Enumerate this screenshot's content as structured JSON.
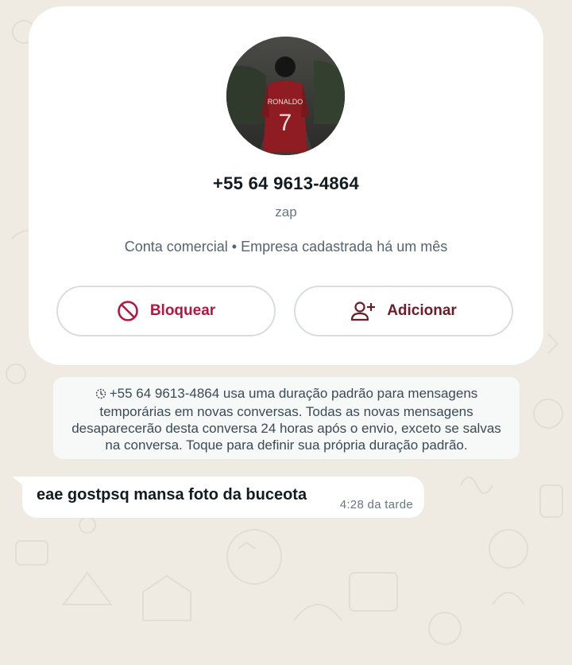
{
  "profile": {
    "phone": "+55 64 9613-4864",
    "name": "zap",
    "business_line": "Conta comercial • Empresa cadastrada há um mês",
    "avatar_shirt_text": "RONALDO",
    "avatar_shirt_number": "7"
  },
  "actions": {
    "block_label": "Bloquear",
    "add_label": "Adicionar"
  },
  "system_message": {
    "text": "+55 64 9613-4864 usa uma duração padrão para mensagens temporárias em novas conversas. Todas as novas mensagens desaparecerão desta conversa 24 horas após o envio, exceto se salvas na conversa. Toque para definir sua própria duração padrão."
  },
  "message": {
    "text": "eae gostpsq mansa foto da buceota",
    "time": "4:28 da tarde"
  },
  "colors": {
    "block_accent": "#b3183f",
    "add_accent": "#6b1d2a",
    "chat_background": "#efeae2"
  },
  "icons": {
    "block": "block-icon",
    "add": "add-contact-icon",
    "timer": "disappearing-timer-icon"
  }
}
